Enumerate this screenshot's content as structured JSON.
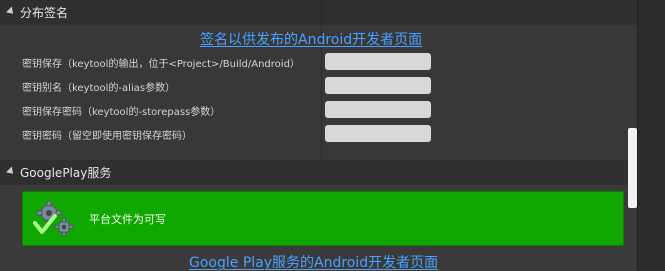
{
  "section1": {
    "title": "分布签名",
    "link": "签名以供发布的Android开发者页面"
  },
  "rows": [
    {
      "label": "密钥保存（keytool的输出，位于<Project>/Build/Android）",
      "value": ""
    },
    {
      "label": "密钥别名（keytool的-alias参数）",
      "value": ""
    },
    {
      "label": "密钥保存密码（keytool的-storepass参数）",
      "value": ""
    },
    {
      "label": "密钥密码（留空即使用密钥保存密码）",
      "value": ""
    }
  ],
  "section2": {
    "title": "GooglePlay服务",
    "notice_text": "平台文件为可写",
    "notice_icon": "gear-check-icon",
    "link": "Google Play服务的Android开发者页面"
  },
  "colors": {
    "notice_bg": "#10a800",
    "link": "#4aa0ff"
  }
}
